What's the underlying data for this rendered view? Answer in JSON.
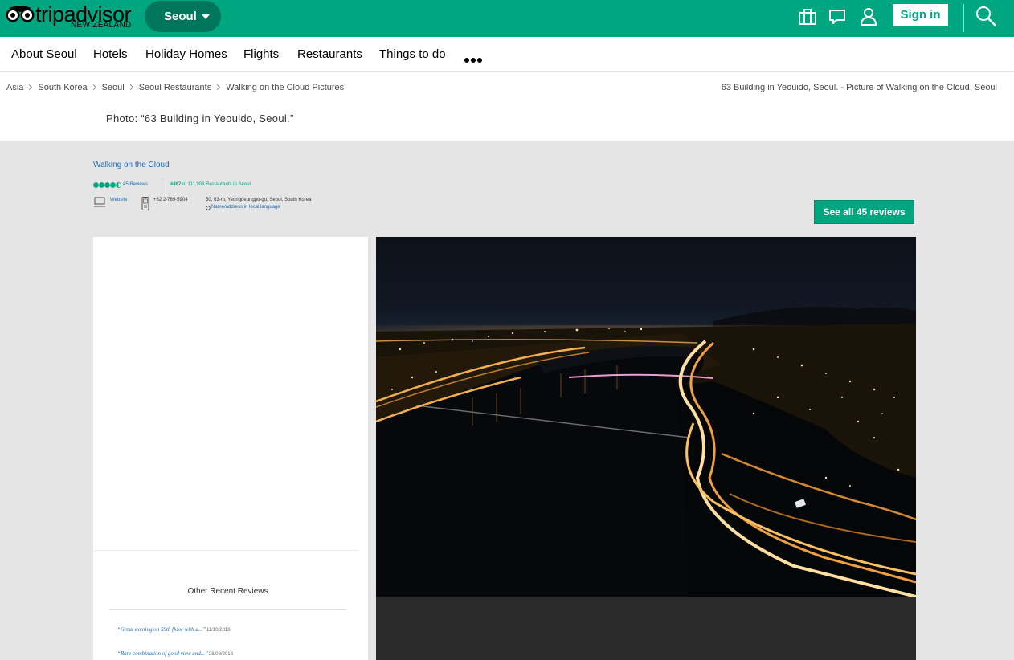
{
  "header": {
    "logo_text": "tripadvisor",
    "logo_sub": "NEW ZEALAND",
    "location": "Seoul",
    "icons": [
      "trips-icon",
      "messages-icon",
      "profile-icon",
      "search-icon"
    ],
    "sign_in": "Sign in",
    "brand_color": "#00a680"
  },
  "nav": {
    "items": [
      "About Seoul",
      "Hotels",
      "Holiday Homes",
      "Flights",
      "Restaurants",
      "Things to do"
    ]
  },
  "breadcrumb": {
    "items": [
      "Asia",
      "South Korea",
      "Seoul",
      "Seoul Restaurants",
      "Walking on the Cloud Pictures"
    ],
    "page_heading": "63 Building in Yeouido, Seoul. - Picture of Walking on the Cloud, Seoul"
  },
  "photo": {
    "caption": "Photo: “63 Building in Yeouido, Seoul.”"
  },
  "restaurant": {
    "name": "Walking on the Cloud",
    "rating": 4.5,
    "reviews": "45 Reviews",
    "rank": "#467",
    "rank_suffix": " of 111,908 Restaurants in Seoul",
    "website": "Website",
    "phone": "+82 2-789-5904",
    "address": "50, 63-ro, Yeongdeungpo-gu, Seoul, South Korea",
    "local_language": "Name/address in local language",
    "see_all": "See all 45 reviews"
  },
  "other_reviews": {
    "title": "Other Recent Reviews",
    "items": [
      {
        "quote": "“Great evening on 59th floor with a...”",
        "date": "11/10/2018"
      },
      {
        "quote": "“Rare combination of good view and...”",
        "date": "28/08/2018"
      }
    ]
  }
}
